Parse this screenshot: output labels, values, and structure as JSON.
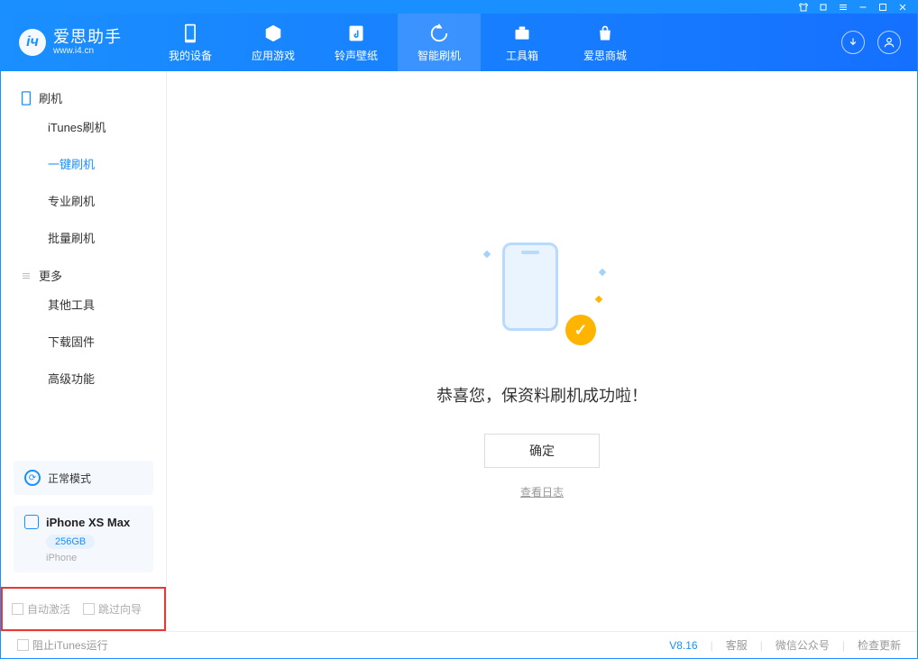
{
  "app": {
    "name": "爱思助手",
    "url": "www.i4.cn"
  },
  "nav": [
    {
      "label": "我的设备"
    },
    {
      "label": "应用游戏"
    },
    {
      "label": "铃声壁纸"
    },
    {
      "label": "智能刷机"
    },
    {
      "label": "工具箱"
    },
    {
      "label": "爱思商城"
    }
  ],
  "sidebar": {
    "section1": "刷机",
    "items1": [
      "iTunes刷机",
      "一键刷机",
      "专业刷机",
      "批量刷机"
    ],
    "section2": "更多",
    "items2": [
      "其他工具",
      "下载固件",
      "高级功能"
    ]
  },
  "mode": "正常模式",
  "device": {
    "name": "iPhone XS Max",
    "storage": "256GB",
    "type": "iPhone"
  },
  "redbox": {
    "opt1": "自动激活",
    "opt2": "跳过向导"
  },
  "content": {
    "message": "恭喜您，保资料刷机成功啦！",
    "ok": "确定",
    "log": "查看日志"
  },
  "footer": {
    "block_itunes": "阻止iTunes运行",
    "version": "V8.16",
    "support": "客服",
    "wechat": "微信公众号",
    "update": "检查更新"
  }
}
